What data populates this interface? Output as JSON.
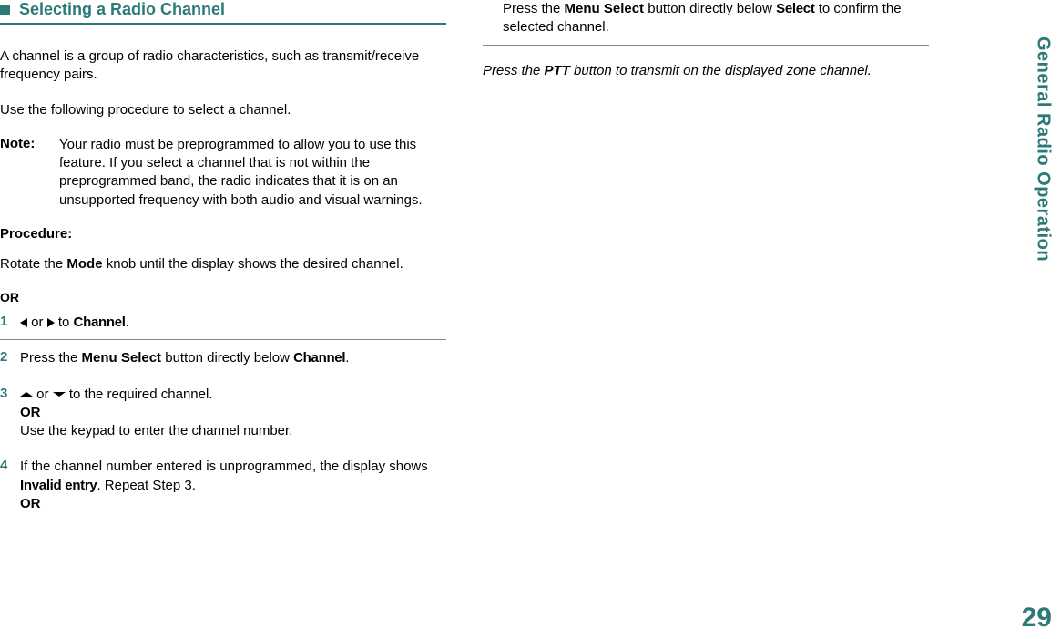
{
  "heading": "Selecting a Radio Channel",
  "intro1": "A channel is a group of radio characteristics, such as transmit/receive frequency pairs.",
  "intro2": "Use the following procedure to select a channel.",
  "note": {
    "label": "Note:",
    "text": "Your radio must be preprogrammed to allow you to use this feature. If you select a channel that is not within the preprogrammed band, the radio indicates that it is on an unsupported frequency with both audio and visual warnings."
  },
  "procedure_label": "Procedure:",
  "rotate_pre": "Rotate the ",
  "rotate_mode": "Mode",
  "rotate_post": " knob until the display shows the desired channel.",
  "or_label": "OR",
  "steps": {
    "1": {
      "num": "1",
      "or": " or ",
      "to": " to ",
      "chan": "Channel",
      "dot": "."
    },
    "2": {
      "num": "2",
      "pre": "Press the ",
      "ms": "Menu Select",
      "mid": " button directly below ",
      "chan": "Channel",
      "dot": "."
    },
    "3": {
      "num": "3",
      "or": " or ",
      "post": " to the required channel.",
      "orlabel": "OR",
      "line2": "Use the keypad to enter the channel number."
    },
    "4": {
      "num": "4",
      "pre": "If the channel number entered is unprogrammed, the display shows ",
      "inv": "Invalid entry",
      "post": ". Repeat Step 3.",
      "orlabel": "OR"
    }
  },
  "right": {
    "pre": "Press the ",
    "ms": "Menu Select",
    "mid": " button directly below ",
    "sel": "Select",
    "post": " to confirm the selected channel."
  },
  "ptt": {
    "pre": "Press the ",
    "ptt": "PTT",
    "post": " button to transmit on the displayed zone channel."
  },
  "sidebar": "General Radio Operation",
  "page_number": "29"
}
